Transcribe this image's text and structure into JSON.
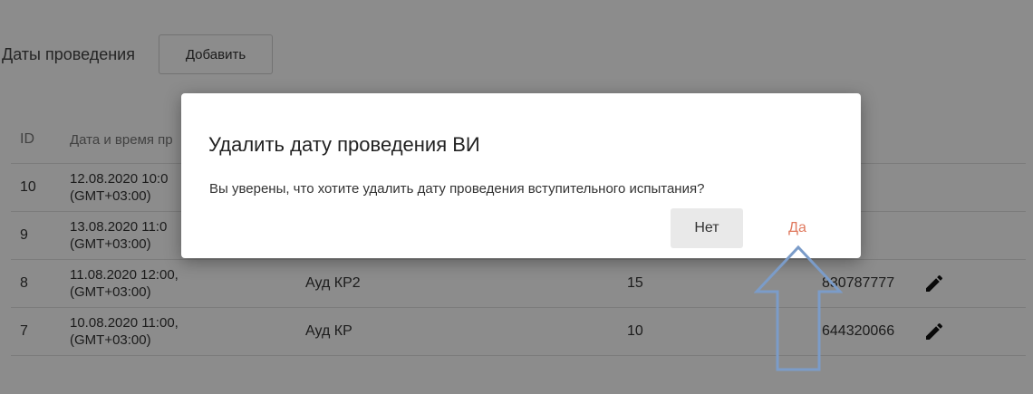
{
  "header": {
    "title": "Даты проведения",
    "add_label": "Добавить"
  },
  "table": {
    "columns": {
      "id": "ID",
      "datetime": "Дата и время пр"
    },
    "rows": [
      {
        "id": "10",
        "date": "12.08.2020 10:0\n(GMT+03:00)",
        "place": "",
        "count": "",
        "code": ""
      },
      {
        "id": "9",
        "date": "13.08.2020 11:0\n(GMT+03:00)",
        "place": "",
        "count": "",
        "code": ""
      },
      {
        "id": "8",
        "date": "11.08.2020 12:00,\n(GMT+03:00)",
        "place": "Ауд КР2",
        "count": "15",
        "code": "830787777"
      },
      {
        "id": "7",
        "date": "10.08.2020 11:00,\n(GMT+03:00)",
        "place": "Ауд КР",
        "count": "10",
        "code": "644320066"
      }
    ]
  },
  "dialog": {
    "title": "Удалить дату проведения ВИ",
    "message": "Вы уверены, что хотите удалить дату проведения вступительного испытания?",
    "no_label": "Нет",
    "yes_label": "Да"
  },
  "colors": {
    "yes_text": "#e07a5f",
    "arrow": "#7b9cc9",
    "overlay": "rgba(0,0,0,0.45)"
  },
  "icons": {
    "edit": "pencil-icon",
    "annotation": "up-arrow-annotation"
  }
}
